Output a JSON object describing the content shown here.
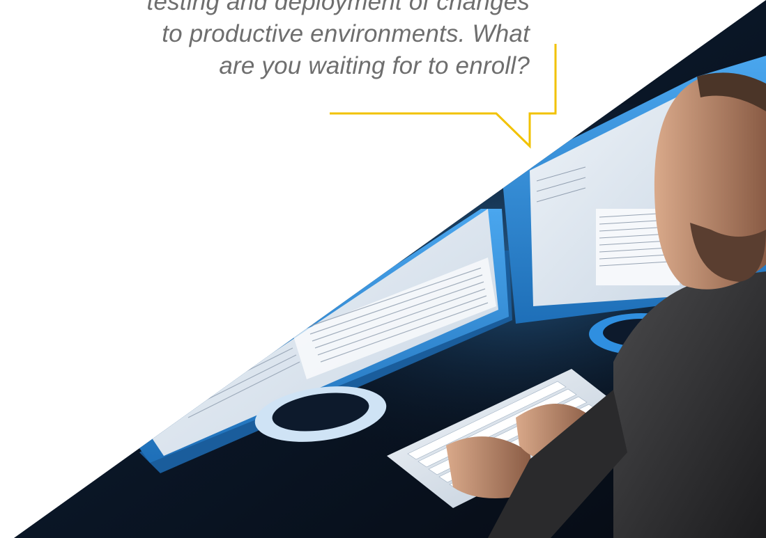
{
  "quote": {
    "lines": [
      "testing and deployment of changes",
      "to productive environments. What",
      "are you waiting for to enroll?"
    ]
  },
  "colors": {
    "background": "#ffffff",
    "quote_text": "#6e6e6e",
    "bubble_outline": "#f2c200",
    "photo_dark": "#0b1220",
    "screen_glow": "#2f8fe0"
  },
  "icons": {
    "bubble": "speech-bubble-outline"
  }
}
